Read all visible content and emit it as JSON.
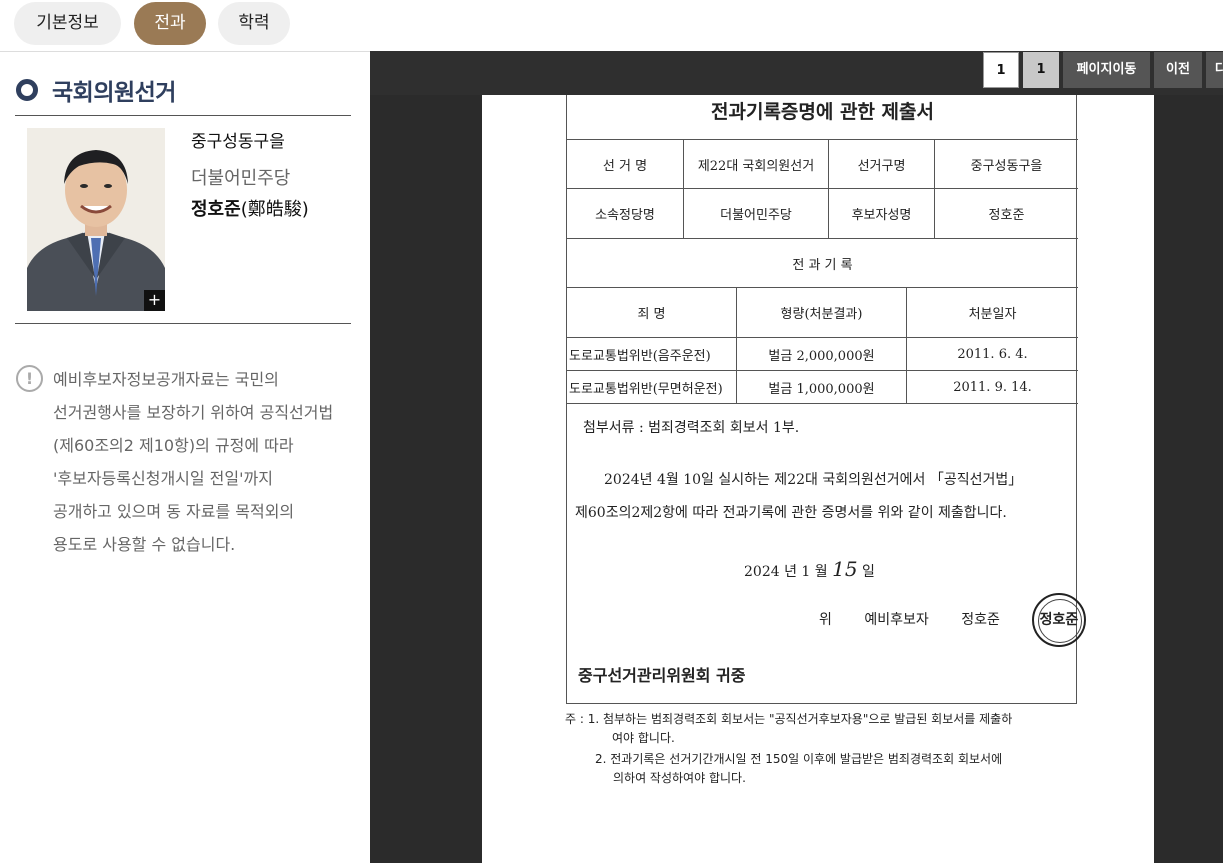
{
  "tabs": [
    {
      "label": "기본정보"
    },
    {
      "label": "전과",
      "active": true
    },
    {
      "label": "학력"
    }
  ],
  "section": {
    "title": "국회의원선거"
  },
  "candidate": {
    "district": "중구성동구을",
    "party": "더불어민주당",
    "name": "정호준",
    "name_hanja": "(鄭皓駿)",
    "enlarge_label": "+"
  },
  "notice": {
    "icon": "!",
    "lines": [
      "예비후보자정보공개자료는 국민의",
      "선거권행사를 보장하기 위하여 공직선거법",
      "(제60조의2 제10항)의 규정에 따라",
      "'후보자등록신청개시일 전일'까지",
      "공개하고 있으며 동 자료를 목적외의",
      "용도로 사용할 수 없습니다."
    ]
  },
  "viewer": {
    "page_current": "1",
    "page_total": "1",
    "go_label": "페이지이동",
    "prev_label": "이전",
    "next_label": "다"
  },
  "document": {
    "title": "전과기록증명에 관한 제출서",
    "info": {
      "election_label": "선  거  명",
      "election_value": "제22대 국회의원선거",
      "district_label": "선거구명",
      "district_value": "중구성동구을",
      "party_label": "소속정당명",
      "party_value": "더불어민주당",
      "candidate_label": "후보자성명",
      "candidate_value": "정호준"
    },
    "record_heading": "전  과  기  록",
    "columns": [
      "죄    명",
      "형량(처분결과)",
      "처분일자"
    ],
    "rows": [
      {
        "crime": "도로교통법위반(음주운전)",
        "penalty": "벌금 2,000,000원",
        "date": "2011. 6. 4."
      },
      {
        "crime": "도로교통법위반(무면허운전)",
        "penalty": "벌금 1,000,000원",
        "date": "2011. 9. 14."
      }
    ],
    "attachment": "첨부서류 : 범죄경력조회 회보서 1부.",
    "body_line1": "2024년 4월 10일 실시하는 제22대 국회의원선거에서 「공직선거법」",
    "body_line2": "제60조의2제2항에 따라 전과기록에 관한 증명서를 위와 같이 제출합니다.",
    "date_prefix": "2024 년  1 월",
    "date_day": "15",
    "date_suffix": "일",
    "sign_wi": "위",
    "sign_role": "예비후보자",
    "sign_name": "정호준",
    "seal_text": "정호준",
    "recipient": "중구선거관리위원회 귀중",
    "note_line1": "주 : 1. 첨부하는 범죄경력조회 회보서는 \"공직선거후보자용\"으로 발급된 회보서를 제출하",
    "note_line2": "여야 합니다.",
    "note_line3": "2. 전과기록은 선거기간개시일 전 150일 이후에 발급받은 범죄경력조회 회보서에",
    "note_line4": "의하여 작성하여야 합니다."
  }
}
